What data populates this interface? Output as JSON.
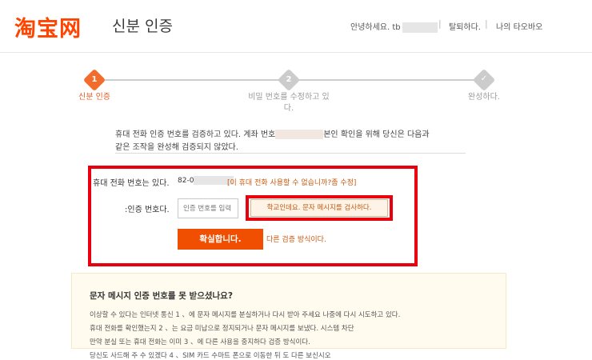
{
  "header": {
    "logo": "淘宝网",
    "title": "신분 인증",
    "greeting": "안녕하세요. tb",
    "logout": "탈퇴하다.",
    "my_taobao": "나의 타오바오",
    "separator": "|"
  },
  "steps": [
    {
      "number": "1",
      "label": "신분 인증"
    },
    {
      "number": "2",
      "label": "비밀 번호를 수정하고 있다."
    },
    {
      "number": "✓",
      "label": "완성하다."
    }
  ],
  "intro": {
    "line1_a": "휴대 전화 인증 번호를 검증하고 있다.   계좌 번호",
    "line1_b": "본인 확인을 위해 당신은 다음과",
    "line2": "같은 조작을 완성해 검증되지 않았다."
  },
  "form": {
    "phone_label": "휴대 전화 번호는 있다.",
    "phone_prefix": "82-0",
    "phone_link": "[이 휴대 전화 사용할 수 없습니까?좀 수정]",
    "code_label": ":인증 번호다.",
    "code_placeholder": "인증 번호를 입력",
    "send_button": "학교인데요. 문자 메시지를 검사하다.",
    "confirm_button": "확실합니다.",
    "alt_link": "다른 검증 방식이다."
  },
  "help": {
    "title": "문자 메시지 인증 번호를 못 받으셨나요?",
    "lines": [
      "이상할 수 있다는 인터넷 통신 1 、에 문자 메시지를 분실하거나 다시 받아 주세요 나중에 다시 시도하고 있다.",
      "휴대 전화를 확인했는지 2 、는 요금 미납으로 정지되거나 문자 메시지를 보냈다. 시스템 차단",
      "만약 분실 또는 휴대 전화는 이미 3 、에 다른 사용을 중지하다 검증 방식이다.",
      "당신도 사드해 주 수 있겠다 4 、SIM 카드 수마트 폰으로 이동한 뒤 도 다른 보신시오"
    ]
  },
  "colors": {
    "brand": "#ff4400",
    "active_step": "#f26c2b",
    "inactive_step": "#cccccc",
    "highlight_border": "#e8000e",
    "confirm_button": "#f04e00"
  }
}
